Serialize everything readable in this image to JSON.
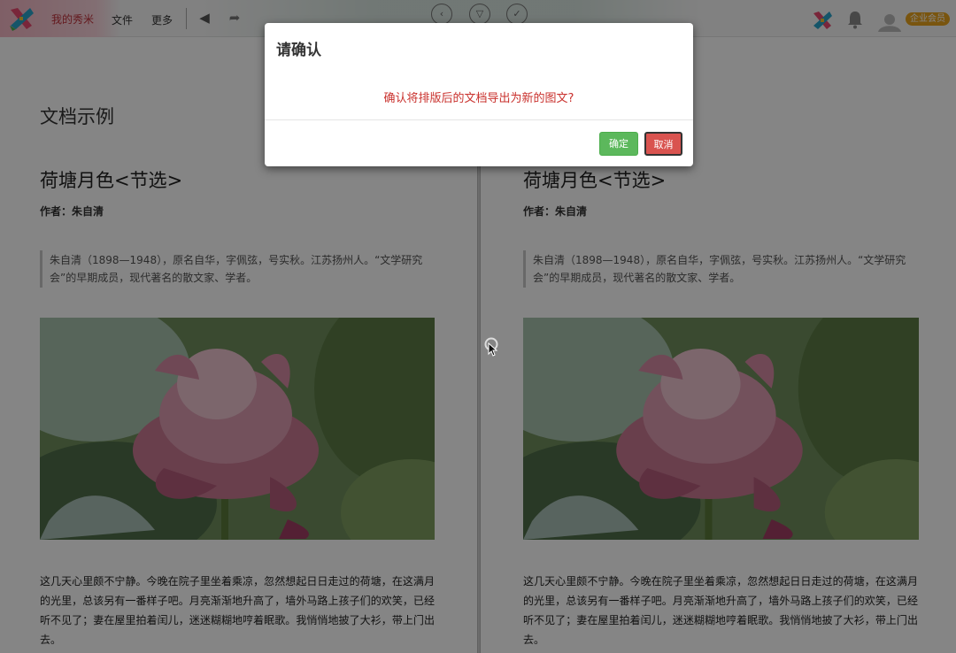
{
  "toolbar": {
    "brand": "我的秀米",
    "menu_file": "文件",
    "menu_more": "更多",
    "icons": [
      "logo-icon",
      "undo-icon",
      "redo-icon",
      "preview-icon",
      "dropdown-icon",
      "check-icon",
      "app-logo-icon",
      "bell-icon",
      "avatar-icon"
    ],
    "member_badge": "企业会员"
  },
  "document": {
    "heading": "文档示例",
    "article_title": "荷塘月色<节选>",
    "author": "作者：朱自清",
    "quote": "朱自清（1898—1948），原名自华，字佩弦，号实秋。江苏扬州人。“文学研究会”的早期成员，现代著名的散文家、学者。",
    "paragraph": "这几天心里颇不宁静。今晚在院子里坐着乘凉，忽然想起日日走过的荷塘，在这满月的光里，总该另有一番样子吧。月亮渐渐地升高了，墙外马路上孩子们的欢笑，已经听不见了；妻在屋里拍着闰儿，迷迷糊糊地哼着眠歌。我悄悄地披了大衫，带上门出去。"
  },
  "modal": {
    "title": "请确认",
    "message": "确认将排版后的文档导出为新的图文?",
    "ok_label": "确定",
    "cancel_label": "取消"
  },
  "colors": {
    "ok_button": "#5cb85c",
    "cancel_button": "#d9534f",
    "message_text": "#c9302c",
    "member_badge": "#e8a31e"
  }
}
